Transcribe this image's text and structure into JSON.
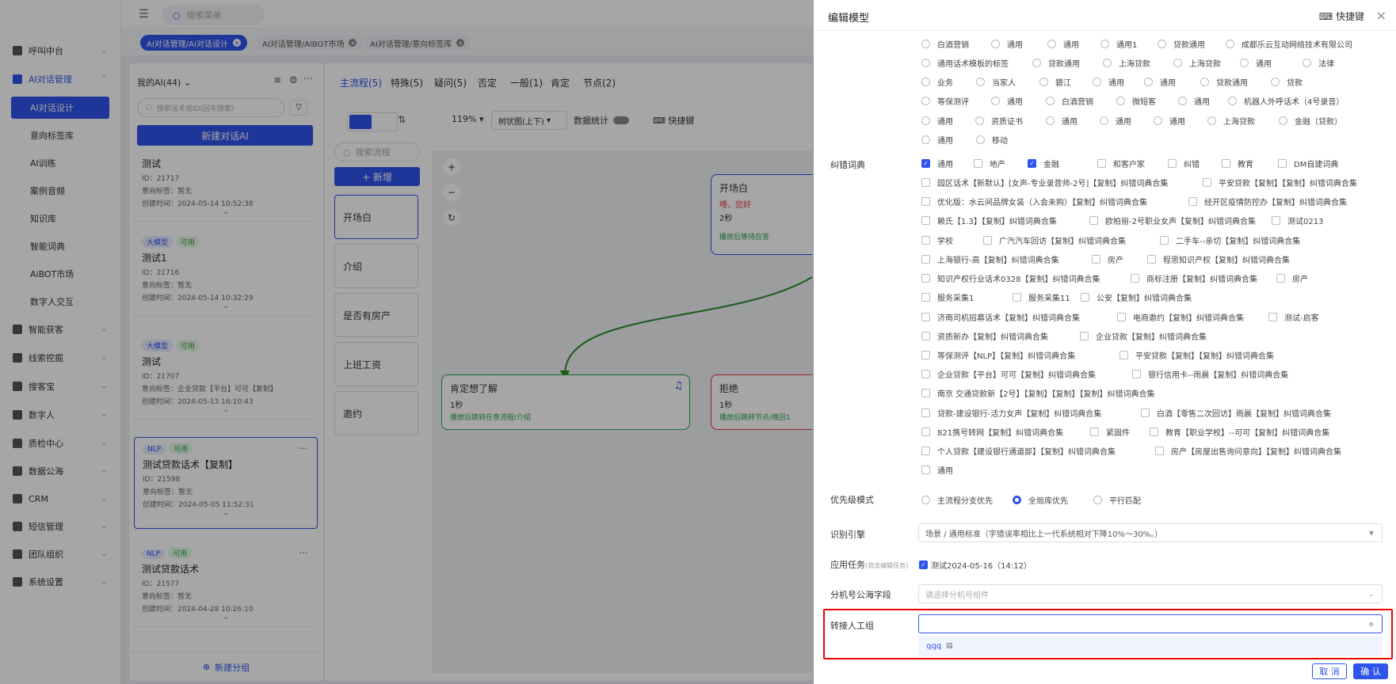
{
  "topbar": {
    "search_placeholder": "搜索菜单"
  },
  "tabs": [
    {
      "label": "AI对话管理/AI对话设计",
      "active": true
    },
    {
      "label": "AI对话管理/AiBOT市场",
      "active": false
    },
    {
      "label": "AI对话管理/意向标签库",
      "active": false
    }
  ],
  "nav": {
    "items": [
      "呼叫中台",
      "AI对话管理",
      "智能获客",
      "线索挖掘",
      "搜客宝",
      "数字人",
      "质检中心",
      "数据公海",
      "CRM",
      "短信管理",
      "团队组织",
      "系统设置"
    ],
    "subitems": [
      "AI对话设计",
      "意向标签库",
      "AI训练",
      "案例音频",
      "知识库",
      "智能词典",
      "AiBOT市场",
      "数字人交互"
    ]
  },
  "ailist": {
    "header": "我的AI(44)",
    "search_placeholder": "搜索话术或ID(回车搜索)",
    "new_button": "新建对话AI",
    "new_group": "新建分组",
    "cards": [
      {
        "badges": [],
        "title": "测试",
        "id": "ID：21717",
        "tag": "意向标签：暂无",
        "time": "创建时间：2024-05-14 10:52:38"
      },
      {
        "badges": [
          "大模型",
          "可用"
        ],
        "title": "测试1",
        "id": "ID：21716",
        "tag": "意向标签：暂无",
        "time": "创建时间：2024-05-14 10:32:29"
      },
      {
        "badges": [
          "大模型",
          "可用"
        ],
        "title": "测试",
        "id": "ID：21707",
        "tag": "意向标签：企业贷款【平台】可可【复制】",
        "time": "创建时间：2024-05-13 16:10:43"
      },
      {
        "badges": [
          "NLP",
          "可用"
        ],
        "title": "测试贷款话术【复制】",
        "id": "ID：21598",
        "tag": "意向标签：暂无",
        "time": "创建时间：2024-05-05 11:52:31"
      },
      {
        "badges": [
          "NLP",
          "可用"
        ],
        "title": "测试贷款话术",
        "id": "ID：21577",
        "tag": "意向标签：暂无",
        "time": "创建时间：2024-04-28 10:26:10"
      }
    ]
  },
  "flow": {
    "tabs": [
      "主流程(5)",
      "特殊(5)",
      "疑问(5)",
      "否定",
      "一般(1)",
      "肯定",
      "节点(2)"
    ],
    "zoom": "119%",
    "layout": "树状图(上下)",
    "stats_label": "数据统计",
    "shortcut": "快捷键",
    "search_placeholder": "搜索流程",
    "add_button": "+ 新增",
    "items": [
      "开场白",
      "介绍",
      "是否有房产",
      "上班工资",
      "邀约"
    ],
    "nodes": [
      {
        "title": "开场白",
        "line1": "喂，您好",
        "line2": "2秒",
        "line3": "播放后等待应答"
      },
      {
        "title": "肯定想了解",
        "line1": "1秒",
        "line2": "播放后跳转任意流程/介绍"
      },
      {
        "title": "拒绝",
        "line1": "1秒",
        "line2": "播放后跳转节点/挽回1"
      }
    ]
  },
  "dialog": {
    "title": "编辑模型",
    "shortcut": "快捷键",
    "top_options": [
      [
        "白酒营销",
        "通用",
        "通用",
        "通用1",
        "贷款通用",
        "成都乐云互动网络技术有限公司"
      ],
      [
        "通用话术模板的标签",
        "贷款通用",
        "上海贷款",
        "上海贷款",
        "通用",
        "法律"
      ],
      [
        "业务",
        "当家人",
        "碧江",
        "通用",
        "通用",
        "贷款通用",
        "贷款"
      ],
      [
        "等保测评",
        "通用",
        "白酒营销",
        "微短客",
        "通用",
        "机器人外呼话术（4号录音）"
      ],
      [
        "通用",
        "资质证书",
        "通用",
        "通用",
        "通用",
        "上海贷款",
        "金融（贷款）"
      ],
      [
        "通用",
        "移动"
      ]
    ],
    "dict_label": "纠错词典",
    "dict_rows": [
      [
        {
          "t": "通用",
          "on": true
        },
        {
          "t": "地产",
          "on": false
        },
        {
          "t": "金融",
          "on": true
        },
        {
          "t": "和客户家",
          "on": false
        },
        {
          "t": "纠错",
          "on": false
        },
        {
          "t": "教育",
          "on": false
        },
        {
          "t": "DM自建词典",
          "on": false
        }
      ],
      [
        {
          "t": "园区话术【新默认】[女声-专业录音师-2号]【复制】纠错词典合集"
        },
        {
          "t": "平安贷款【复制】【复制】纠错词典合集"
        }
      ],
      [
        {
          "t": "优化版：水云间品牌女装（入会未购）【复制】纠错词典合集"
        },
        {
          "t": "经开区疫情防控办【复制】纠错词典合集"
        }
      ],
      [
        {
          "t": "赖氏【1.3】【复制】纠错词典合集"
        },
        {
          "t": "欧柏丽-2号职业女声【复制】纠错词典合集"
        },
        {
          "t": "测试0213"
        }
      ],
      [
        {
          "t": "学校"
        },
        {
          "t": "广汽汽车回访【复制】纠错词典合集"
        },
        {
          "t": "二手车--亲切【复制】纠错词典合集"
        }
      ],
      [
        {
          "t": "上海银行-高【复制】纠错词典合集"
        },
        {
          "t": "房产"
        },
        {
          "t": "程思知识产权【复制】纠错词典合集"
        }
      ],
      [
        {
          "t": "知识产权行业话术0328【复制】纠错词典合集"
        },
        {
          "t": "商标注册【复制】纠错词典合集"
        },
        {
          "t": "房产"
        }
      ],
      [
        {
          "t": "服务采集1"
        },
        {
          "t": "服务采集11"
        },
        {
          "t": "公安【复制】纠错词典合集"
        }
      ],
      [
        {
          "t": "济南司机招募话术【复制】纠错词典合集"
        },
        {
          "t": "电商邀约【复制】纠错词典合集"
        },
        {
          "t": "测试-启客"
        }
      ],
      [
        {
          "t": "资质新办【复制】纠错词典合集"
        },
        {
          "t": "企业贷款【复制】纠错词典合集"
        }
      ],
      [
        {
          "t": "等保测评【NLP】【复制】纠错词典合集"
        },
        {
          "t": "平安贷款【复制】【复制】纠错词典合集"
        }
      ],
      [
        {
          "t": "企业贷款【平台】可可【复制】纠错词典合集"
        },
        {
          "t": "银行信用卡--雨晨【复制】纠错词典合集"
        }
      ],
      [
        {
          "t": "南京 交通贷款新【2号】【复制】【复制】【复制】纠错词典合集"
        }
      ],
      [
        {
          "t": "贷款-建设银行-活力女声【复制】纠错词典合集"
        },
        {
          "t": "白酒【零售二次回访】雨晨【复制】纠错词典合集"
        }
      ],
      [
        {
          "t": "821携号转网【复制】纠错词典合集"
        },
        {
          "t": "紧固件"
        },
        {
          "t": "教育【职业学校】--可可【复制】纠错词典合集"
        }
      ],
      [
        {
          "t": "个人贷款【建设银行通道部】【复制】纠错词典合集"
        },
        {
          "t": "房产【房屋出售询问意向】【复制】纠错词典合集"
        }
      ],
      [
        {
          "t": "通用"
        }
      ]
    ],
    "priority_label": "优先级模式",
    "priority_options": [
      {
        "t": "主流程分支优先",
        "on": false
      },
      {
        "t": "全局库优先",
        "on": true
      },
      {
        "t": "平行匹配",
        "on": false
      }
    ],
    "engine_label": "识别引擎",
    "engine_value": "场景 / 通用标准（字错误率相比上一代系统相对下降10%～30%。）",
    "task_label": "应用任务",
    "task_hint": "(双击编辑任务)",
    "task_value": "测试2024-05-16（14:12）",
    "ext_label": "分机号公海字段",
    "ext_placeholder": "请选择分机号组件",
    "transfer_label": "转接人工组",
    "transfer_value": "",
    "transfer_option": "qqq",
    "cancel": "取 消",
    "confirm": "确 认"
  }
}
